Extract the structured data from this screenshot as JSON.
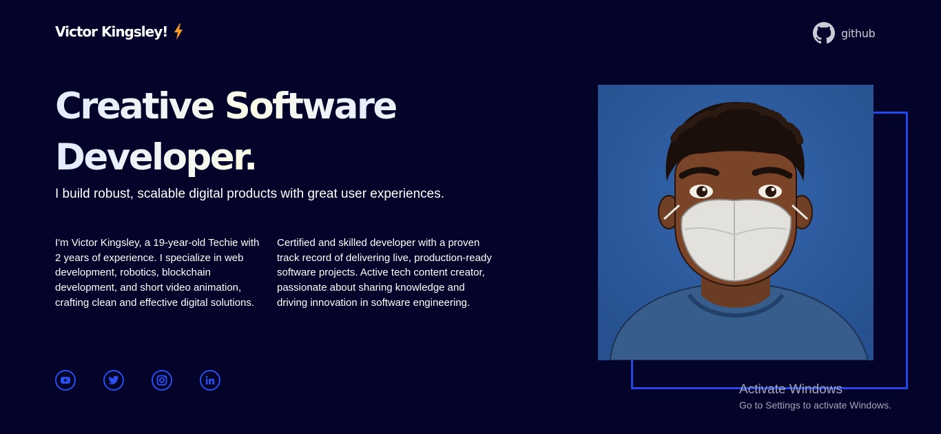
{
  "header": {
    "brand_name": "Victor Kingsley!",
    "brand_icon": "lightning-bolt-icon",
    "github_label": "github",
    "github_icon": "github-icon"
  },
  "hero": {
    "title_line1": "Creative Software",
    "title_line2": "Developer.",
    "subtitle": "I build robust, scalable digital products with great user experiences.",
    "bio_left": "I'm Victor Kingsley, a 19-year-old Techie with 2 years of experience. I specialize in web development, robotics, blockchain development, and short video animation, crafting clean and effective digital solutions.",
    "bio_right": "Certified and skilled developer with a proven track record of delivering live, production-ready software projects. Active tech content creator, passionate about sharing knowledge and driving innovation in software engineering."
  },
  "socials": [
    {
      "icon": "youtube-icon"
    },
    {
      "icon": "twitter-icon"
    },
    {
      "icon": "instagram-icon"
    },
    {
      "icon": "linkedin-icon"
    }
  ],
  "portrait": {
    "icon": "avatar-illustration"
  },
  "watermark": {
    "title": "Activate Windows",
    "subtitle": "Go to Settings to activate Windows."
  },
  "colors": {
    "background": "#04032a",
    "accent": "#2347e8",
    "bolt": "#f79a2a",
    "text": "#ffffff"
  }
}
